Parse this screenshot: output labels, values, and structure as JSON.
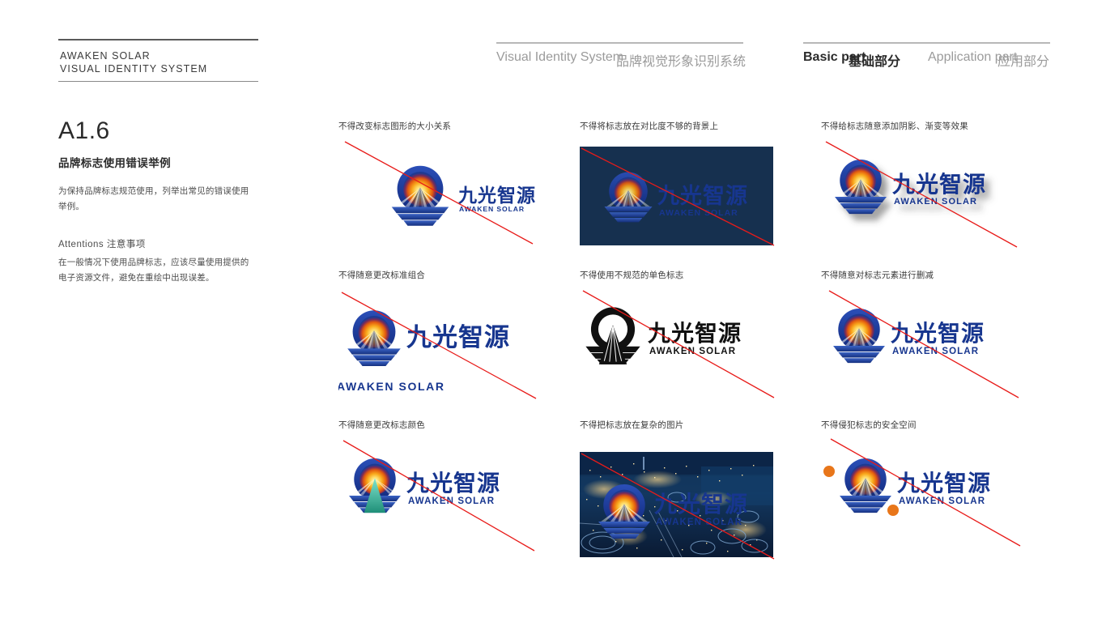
{
  "brand": {
    "line1": "AWAKEN SOLAR",
    "line2": "VISUAL IDENTITY SYSTEM"
  },
  "header": {
    "left_label_en": "Visual Identity System",
    "left_label_zh": "品牌视觉形象识别系统",
    "nav": [
      {
        "en": "Basic part",
        "zh": "基础部分",
        "active": true
      },
      {
        "en": "Application part",
        "zh": "应用部分",
        "active": false
      }
    ]
  },
  "section": {
    "number": "A1.6",
    "title": "品牌标志使用错误举例",
    "description": "为保持品牌标志规范使用，列举出常见的错误使用举例。",
    "attentions_heading": "Attentions 注意事项",
    "attentions_body": "在一般情况下使用品牌标志，应该尽量使用提供的电子资源文件，避免在重绘中出现误差。"
  },
  "logo": {
    "wordmark_zh": "九光智源",
    "wordmark_en": "AWAKEN SOLAR",
    "colors": {
      "blue_dark": "#17368f",
      "blue": "#1b3f9e",
      "sun_orange": "#f2920f",
      "sun_yellow": "#ffe07a",
      "sun_red": "#d94f12",
      "dark_bg": "#16304f",
      "error_slash": "#e81b19",
      "encroach_dot": "#e8761a",
      "wrong_green": "#3fb8a0"
    }
  },
  "examples": [
    {
      "id": "size-relationship",
      "caption": "不得改变标志图形的大小关系"
    },
    {
      "id": "low-contrast-bg",
      "caption": "不得将标志放在对比度不够的背景上"
    },
    {
      "id": "shadow-gradient",
      "caption": "不得给标志随意添加阴影、渐变等效果"
    },
    {
      "id": "rearranged-lockup",
      "caption": "不得随意更改标准组合"
    },
    {
      "id": "bad-monochrome",
      "caption": "不得使用不规范的单色标志"
    },
    {
      "id": "removed-elements",
      "caption": "不得随意对标志元素进行删减"
    },
    {
      "id": "changed-colors",
      "caption": "不得随意更改标志颜色"
    },
    {
      "id": "busy-photo-bg",
      "caption": "不得把标志放在复杂的图片"
    },
    {
      "id": "safe-space",
      "caption": "不得侵犯标志的安全空间"
    }
  ]
}
